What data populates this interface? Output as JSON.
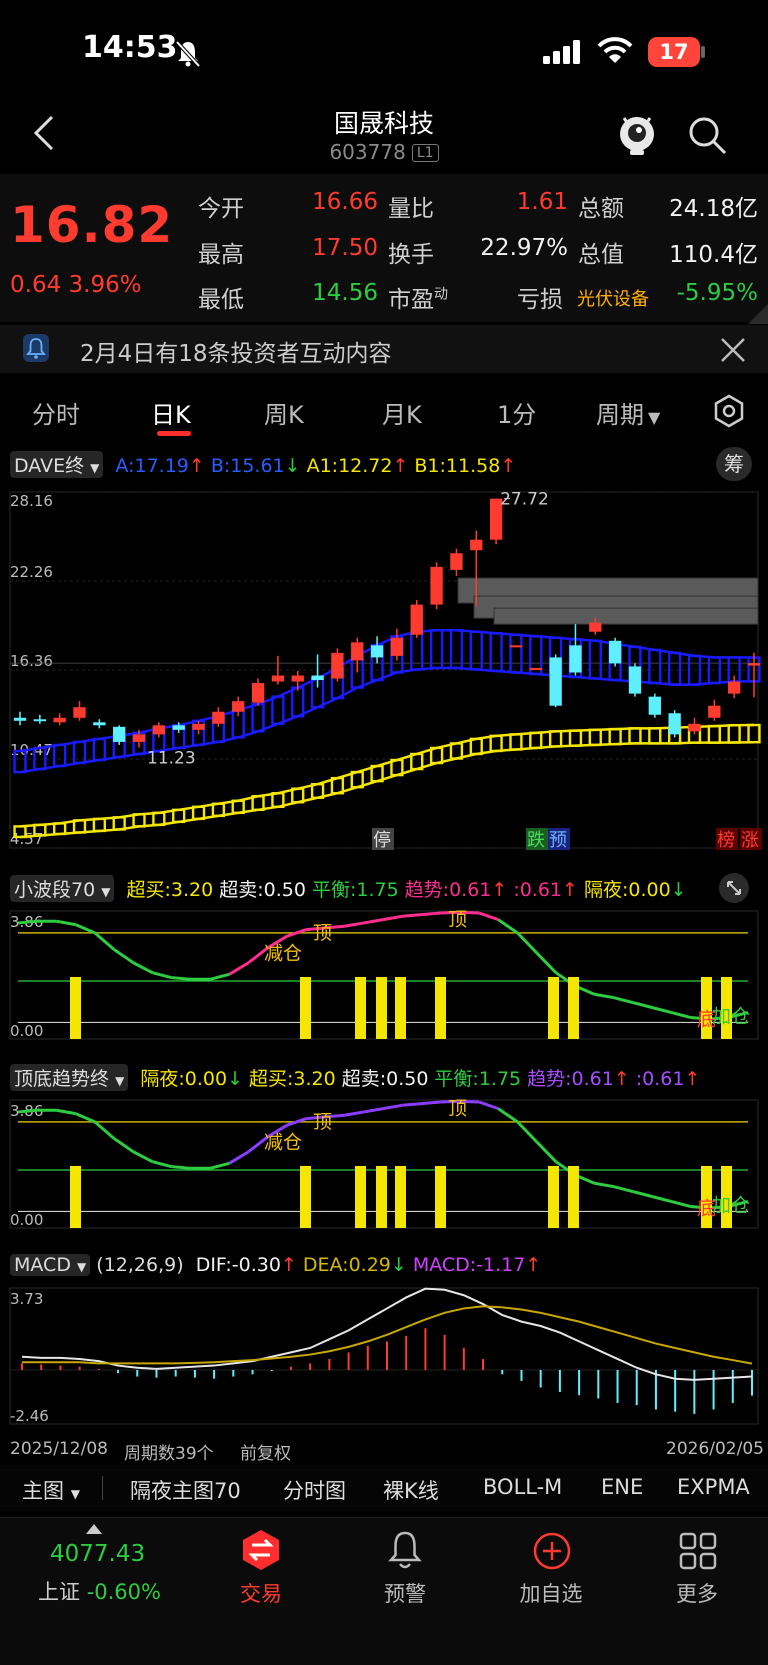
{
  "status": {
    "time": "14:53",
    "battery": "17"
  },
  "header": {
    "title": "国晟科技",
    "code": "603778",
    "badge": "L1"
  },
  "quote": {
    "price": "16.82",
    "change": "0.64",
    "change_pct": "3.96%",
    "fields": [
      {
        "label": "今开",
        "value": "16.66",
        "color": "red"
      },
      {
        "label": "量比",
        "value": "1.61",
        "color": "red"
      },
      {
        "label": "总额",
        "value": "24.18亿",
        "color": "white"
      },
      {
        "label": "最高",
        "value": "17.50",
        "color": "red"
      },
      {
        "label": "换手",
        "value": "22.97%",
        "color": "white"
      },
      {
        "label": "总值",
        "value": "110.4亿",
        "color": "white"
      },
      {
        "label": "最低",
        "value": "14.56",
        "color": "green"
      },
      {
        "label": "市盈",
        "sup": "动",
        "value": "",
        "color": "white"
      },
      {
        "label": "亏损",
        "value": "",
        "color": "white"
      }
    ],
    "sector": "光伏设备",
    "sector_change": "-5.95%"
  },
  "notice": {
    "text": "2月4日有18条投资者互动内容"
  },
  "tabs": [
    "分时",
    "日K",
    "周K",
    "月K",
    "1分",
    "周期"
  ],
  "main_chart": {
    "indicator": "DAVE终",
    "values": [
      {
        "text": "A:17.19",
        "color": "#2a5cff",
        "arrow": "↑",
        "arrow_color": "#ff3b30"
      },
      {
        "text": "B:15.61",
        "color": "#2a5cff",
        "arrow": "↓",
        "arrow_color": "#2ecc40"
      },
      {
        "text": "A1:12.72",
        "color": "#f5e600",
        "arrow": "↑",
        "arrow_color": "#ff3b30"
      },
      {
        "text": "B1:11.58",
        "color": "#f5e600",
        "arrow": "↑",
        "arrow_color": "#ff3b30"
      }
    ],
    "chip_label": "筹",
    "y_labels": [
      "28.16",
      "22.26",
      "16.36",
      "10.47",
      "4.57"
    ],
    "high_label": "27.72",
    "low_label": "11.23",
    "markers": [
      "停",
      "跌",
      "预",
      "榜",
      "涨"
    ]
  },
  "wave_chart": {
    "indicator": "小波段70",
    "values": [
      {
        "text": "超买:3.20",
        "color": "#f5e600"
      },
      {
        "text": "超卖:0.50",
        "color": "#f2f2f2"
      },
      {
        "text": "平衡:1.75",
        "color": "#2ecc40"
      },
      {
        "text": "趋势:0.61",
        "color": "#ff2d8f",
        "arrow": "↑",
        "arrow_color": "#ff3b30"
      },
      {
        "text": ":0.61",
        "color": "#ff2d8f",
        "arrow": "↑",
        "arrow_color": "#ff3b30"
      },
      {
        "text": "隔夜:0.00",
        "color": "#f5e600",
        "arrow": "↓",
        "arrow_color": "#2ecc40"
      }
    ],
    "y_top": "3.86",
    "y_bottom": "0.00",
    "labels": {
      "top1": "顶",
      "top2": "顶",
      "reduce": "减仓",
      "bottom": "底",
      "add": "加仓"
    }
  },
  "trend_chart": {
    "indicator": "顶底趋势终",
    "values": [
      {
        "text": "隔夜:0.00",
        "color": "#f5e600",
        "arrow": "↓",
        "arrow_color": "#2ecc40"
      },
      {
        "text": "超买:3.20",
        "color": "#f5e600"
      },
      {
        "text": "超卖:0.50",
        "color": "#f2f2f2"
      },
      {
        "text": "平衡:1.75",
        "color": "#2ecc40"
      },
      {
        "text": "趋势:0.61",
        "color": "#a64dff",
        "arrow": "↑",
        "arrow_color": "#ff3b30"
      },
      {
        "text": ":0.61",
        "color": "#a64dff",
        "arrow": "↑",
        "arrow_color": "#ff3b30"
      }
    ],
    "y_top": "3.86",
    "y_bottom": "0.00",
    "labels": {
      "top1": "顶",
      "top2": "顶",
      "reduce": "减仓",
      "bottom": "底",
      "add": "加仓"
    }
  },
  "macd_chart": {
    "indicator": "MACD",
    "params": "(12,26,9)",
    "values": [
      {
        "text": "DIF:-0.30",
        "color": "#f2f2f2",
        "arrow": "↑",
        "arrow_color": "#ff3b30"
      },
      {
        "text": "DEA:0.29",
        "color": "#d4b800",
        "arrow": "↓",
        "arrow_color": "#2ecc40"
      },
      {
        "text": "MACD:-1.17",
        "color": "#d040ff",
        "arrow": "↑",
        "arrow_color": "#ff3b30"
      }
    ],
    "y_top": "3.73",
    "y_bottom": "-2.46"
  },
  "axis": {
    "start_date": "2025/12/08",
    "period_count": "周期数39个",
    "adjust": "前复权",
    "end_date": "2026/02/05"
  },
  "subtabs": [
    "主图",
    "隔夜主图70",
    "分时图",
    "裸K线",
    "BOLL-M",
    "ENE",
    "EXPMA"
  ],
  "tabbar": {
    "index_value": "4077.43",
    "index_name": "上证",
    "index_change": "-0.60%",
    "items": [
      "交易",
      "预警",
      "加自选",
      "更多"
    ]
  },
  "colors": {
    "up": "#ff3b30",
    "down": "#5ff0ff",
    "band_blue": "#1a1aff",
    "band_yellow": "#f5e600"
  },
  "chart_data": {
    "type": "candlestick",
    "candles": [
      {
        "o": 13.2,
        "c": 13.0,
        "h": 13.6,
        "l": 12.7
      },
      {
        "o": 13.1,
        "c": 13.0,
        "h": 13.4,
        "l": 12.8
      },
      {
        "o": 12.9,
        "c": 13.2,
        "h": 13.5,
        "l": 12.7
      },
      {
        "o": 13.2,
        "c": 13.9,
        "h": 14.3,
        "l": 13.0
      },
      {
        "o": 12.9,
        "c": 12.7,
        "h": 13.1,
        "l": 12.5
      },
      {
        "o": 12.6,
        "c": 11.6,
        "h": 12.7,
        "l": 11.4
      },
      {
        "o": 11.6,
        "c": 12.1,
        "h": 12.4,
        "l": 11.23
      },
      {
        "o": 12.1,
        "c": 12.7,
        "h": 12.9,
        "l": 11.9
      },
      {
        "o": 12.7,
        "c": 12.4,
        "h": 12.9,
        "l": 12.2
      },
      {
        "o": 12.4,
        "c": 12.8,
        "h": 13.0,
        "l": 12.1
      },
      {
        "o": 12.8,
        "c": 13.6,
        "h": 13.9,
        "l": 12.6
      },
      {
        "o": 13.6,
        "c": 14.3,
        "h": 14.6,
        "l": 13.3
      },
      {
        "o": 14.2,
        "c": 15.5,
        "h": 15.8,
        "l": 14.0
      },
      {
        "o": 15.6,
        "c": 16.0,
        "h": 17.3,
        "l": 15.4
      },
      {
        "o": 15.6,
        "c": 16.0,
        "h": 16.3,
        "l": 15.0
      },
      {
        "o": 16.0,
        "c": 15.7,
        "h": 17.4,
        "l": 15.2
      },
      {
        "o": 15.8,
        "c": 17.5,
        "h": 17.8,
        "l": 15.6
      },
      {
        "o": 17.0,
        "c": 18.2,
        "h": 18.5,
        "l": 16.2
      },
      {
        "o": 18.0,
        "c": 17.2,
        "h": 18.6,
        "l": 16.8
      },
      {
        "o": 17.3,
        "c": 18.5,
        "h": 19.1,
        "l": 17.0
      },
      {
        "o": 18.7,
        "c": 20.7,
        "h": 21.0,
        "l": 18.5
      },
      {
        "o": 20.7,
        "c": 23.2,
        "h": 23.5,
        "l": 20.4
      },
      {
        "o": 23.0,
        "c": 24.1,
        "h": 24.4,
        "l": 22.6
      },
      {
        "o": 24.3,
        "c": 25.0,
        "h": 25.6,
        "l": 20.6
      },
      {
        "o": 25.0,
        "c": 27.72,
        "h": 27.72,
        "l": 24.7
      },
      {
        "o": 18.0,
        "c": 18.0,
        "h": 18.0,
        "l": 18.0
      },
      {
        "o": 16.5,
        "c": 16.5,
        "h": 16.5,
        "l": 16.5
      },
      {
        "o": 17.2,
        "c": 14.0,
        "h": 17.4,
        "l": 13.9
      },
      {
        "o": 18.0,
        "c": 16.2,
        "h": 19.4,
        "l": 16.0
      },
      {
        "o": 18.9,
        "c": 19.5,
        "h": 19.8,
        "l": 18.7
      },
      {
        "o": 18.3,
        "c": 16.8,
        "h": 18.5,
        "l": 16.6
      },
      {
        "o": 16.6,
        "c": 14.8,
        "h": 16.8,
        "l": 14.6
      },
      {
        "o": 14.6,
        "c": 13.4,
        "h": 14.8,
        "l": 13.2
      },
      {
        "o": 13.5,
        "c": 12.1,
        "h": 13.7,
        "l": 11.9
      },
      {
        "o": 12.3,
        "c": 12.8,
        "h": 13.2,
        "l": 12.1
      },
      {
        "o": 13.2,
        "c": 14.0,
        "h": 14.4,
        "l": 13.0
      },
      {
        "o": 14.8,
        "c": 15.6,
        "h": 16.0,
        "l": 14.5
      },
      {
        "o": 16.66,
        "c": 16.82,
        "h": 17.5,
        "l": 14.56
      }
    ],
    "band_ab": [
      [
        11.0,
        9.6
      ],
      [
        11.2,
        9.8
      ],
      [
        11.4,
        10.0
      ],
      [
        11.6,
        10.2
      ],
      [
        11.8,
        10.4
      ],
      [
        12.0,
        10.6
      ],
      [
        12.2,
        10.8
      ],
      [
        12.5,
        11.0
      ],
      [
        12.7,
        11.2
      ],
      [
        13.0,
        11.4
      ],
      [
        13.3,
        11.6
      ],
      [
        13.7,
        11.9
      ],
      [
        14.1,
        12.3
      ],
      [
        14.6,
        12.8
      ],
      [
        15.2,
        13.3
      ],
      [
        15.8,
        13.9
      ],
      [
        16.5,
        14.5
      ],
      [
        17.3,
        15.2
      ],
      [
        18.0,
        15.7
      ],
      [
        18.6,
        16.2
      ],
      [
        18.9,
        16.4
      ],
      [
        19.0,
        16.5
      ],
      [
        19.0,
        16.5
      ],
      [
        18.9,
        16.4
      ],
      [
        18.8,
        16.3
      ],
      [
        18.7,
        16.2
      ],
      [
        18.6,
        16.1
      ],
      [
        18.5,
        16.0
      ],
      [
        18.4,
        15.9
      ],
      [
        18.3,
        15.8
      ],
      [
        18.1,
        15.7
      ],
      [
        17.9,
        15.6
      ],
      [
        17.7,
        15.5
      ],
      [
        17.5,
        15.4
      ],
      [
        17.3,
        15.4
      ],
      [
        17.2,
        15.5
      ],
      [
        17.2,
        15.6
      ],
      [
        17.19,
        15.61
      ]
    ],
    "band_a1b1": [
      [
        6.0,
        5.3
      ],
      [
        6.1,
        5.4
      ],
      [
        6.2,
        5.5
      ],
      [
        6.4,
        5.6
      ],
      [
        6.5,
        5.7
      ],
      [
        6.6,
        5.8
      ],
      [
        6.8,
        6.0
      ],
      [
        6.9,
        6.1
      ],
      [
        7.1,
        6.3
      ],
      [
        7.3,
        6.5
      ],
      [
        7.5,
        6.7
      ],
      [
        7.7,
        6.9
      ],
      [
        8.0,
        7.1
      ],
      [
        8.2,
        7.3
      ],
      [
        8.5,
        7.6
      ],
      [
        8.8,
        7.9
      ],
      [
        9.2,
        8.2
      ],
      [
        9.6,
        8.6
      ],
      [
        10.0,
        9.0
      ],
      [
        10.4,
        9.4
      ],
      [
        10.8,
        9.8
      ],
      [
        11.2,
        10.2
      ],
      [
        11.5,
        10.5
      ],
      [
        11.8,
        10.8
      ],
      [
        12.0,
        11.0
      ],
      [
        12.1,
        11.1
      ],
      [
        12.2,
        11.2
      ],
      [
        12.3,
        11.3
      ],
      [
        12.35,
        11.35
      ],
      [
        12.4,
        11.4
      ],
      [
        12.45,
        11.45
      ],
      [
        12.5,
        11.5
      ],
      [
        12.5,
        11.5
      ],
      [
        12.55,
        11.5
      ],
      [
        12.6,
        11.55
      ],
      [
        12.65,
        11.55
      ],
      [
        12.7,
        11.56
      ],
      [
        12.72,
        11.58
      ]
    ],
    "ylim": [
      4.57,
      28.16
    ]
  }
}
